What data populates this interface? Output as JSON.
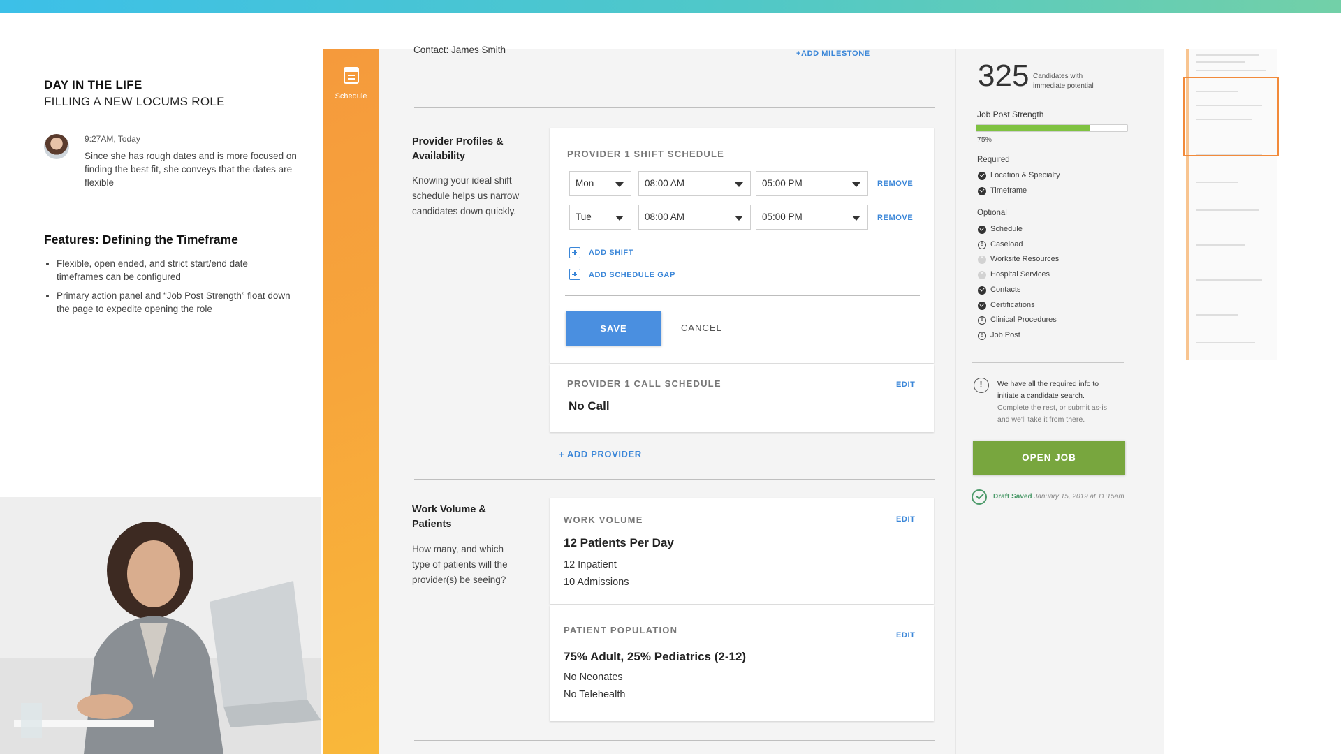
{
  "story": {
    "title": "DAY IN THE LIFE",
    "subtitle": "FILLING A NEW LOCUMS ROLE",
    "message_time": "9:27AM, Today",
    "message_text": "Since she has rough dates and is more focused on finding the best fit, she conveys that the dates are flexible",
    "features_title": "Features: Defining the Timeframe",
    "features": [
      "Flexible, open ended, and strict start/end date timeframes can be configured",
      "Primary action panel and “Job Post Strength” float down the page to expedite opening the role"
    ]
  },
  "rail": {
    "label": "Schedule",
    "icon": "calendar-icon"
  },
  "top": {
    "contact": "Contact: James Smith",
    "add_milestone": "+ADD MILESTONE"
  },
  "providers": {
    "title": "Provider Profiles & Availability",
    "description": "Knowing your ideal shift schedule helps us narrow candidates down quickly.",
    "shift_header": "PROVIDER 1 SHIFT SCHEDULE",
    "shifts": [
      {
        "day": "Mon",
        "start": "08:00 AM",
        "end": "05:00 PM",
        "remove": "REMOVE"
      },
      {
        "day": "Tue",
        "start": "08:00 AM",
        "end": "05:00 PM",
        "remove": "REMOVE"
      }
    ],
    "add_shift": "ADD SHIFT",
    "add_gap": "ADD SCHEDULE GAP",
    "save": "SAVE",
    "cancel": "CANCEL",
    "call_header": "PROVIDER 1 CALL SCHEDULE",
    "call_edit": "EDIT",
    "call_value": "No Call",
    "add_provider": "+ ADD PROVIDER"
  },
  "work": {
    "title": "Work Volume & Patients",
    "description": "How many, and which type of patients will the provider(s) be seeing?",
    "volume_header": "WORK VOLUME",
    "volume_edit": "EDIT",
    "volume_main": "12 Patients Per Day",
    "volume_lines": [
      "12 Inpatient",
      "10 Admissions"
    ],
    "population_header": "PATIENT POPULATION",
    "population_edit": "EDIT",
    "population_main": "75% Adult, 25% Pediatrics (2-12)",
    "population_lines": [
      "No Neonates",
      "No Telehealth"
    ]
  },
  "panel": {
    "count": "325",
    "count_label": "Candidates with immediate potential",
    "strength_label": "Job Post Strength",
    "strength_value": 0.75,
    "strength_text": "75%",
    "required_label": "Required",
    "required": [
      {
        "label": "Location & Specialty",
        "status": "done"
      },
      {
        "label": "Timeframe",
        "status": "done"
      }
    ],
    "optional_label": "Optional",
    "optional": [
      {
        "label": "Schedule",
        "status": "done"
      },
      {
        "label": "Caseload",
        "status": "warn"
      },
      {
        "label": "Worksite Resources",
        "status": "none"
      },
      {
        "label": "Hospital Services",
        "status": "none"
      },
      {
        "label": "Contacts",
        "status": "done"
      },
      {
        "label": "Certifications",
        "status": "done"
      },
      {
        "label": "Clinical Procedures",
        "status": "warn"
      },
      {
        "label": "Job Post",
        "status": "warn"
      }
    ],
    "info_primary": "We have all the required info to initiate a candidate search.",
    "info_secondary": "Complete the rest, or submit as-is and we'll take it from there.",
    "open_job": "OPEN JOB",
    "draft_saved": "Draft Saved",
    "draft_time": "January 15, 2019 at 11:15am"
  },
  "colors": {
    "accent": "#3a86d8",
    "save": "#4a8fe0",
    "open": "#78a63e",
    "rail": "#f7a53b",
    "progress": "#7fc241"
  }
}
